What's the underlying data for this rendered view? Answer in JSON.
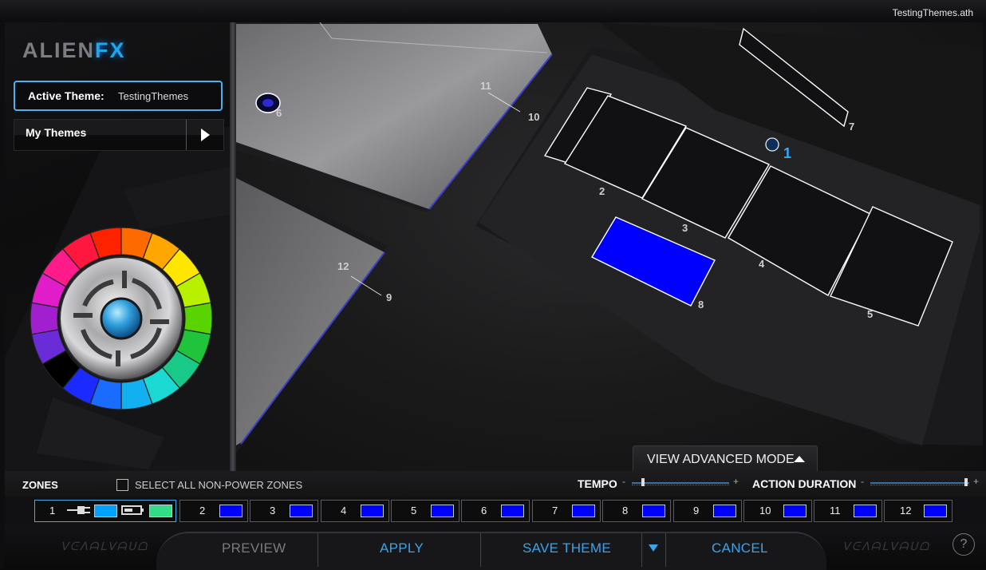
{
  "window": {
    "file_name": "TestingThemes.ath"
  },
  "sidebar": {
    "logo_part1": "ALIEN",
    "logo_part2": "FX",
    "active_theme_label": "Active Theme:",
    "active_theme_value": "TestingThemes",
    "my_themes_label": "My Themes"
  },
  "scene": {
    "zone_labels": [
      "1",
      "2",
      "3",
      "4",
      "5",
      "6",
      "7",
      "8",
      "9",
      "10",
      "11",
      "12"
    ],
    "view_advanced_label": "VIEW ADVANCED MODE"
  },
  "zones_bar": {
    "zones_label": "ZONES",
    "select_all_label": "SELECT ALL NON-POWER ZONES",
    "tempo_label": "TEMPO",
    "action_duration_label": "ACTION DURATION",
    "slider_minus": "-",
    "slider_plus": "+",
    "tempo_level": 0.1,
    "action_duration_level": 0.95
  },
  "zones": [
    {
      "label": "1",
      "power": true,
      "ac_color": "#00a2ff",
      "battery_color": "#33dd88"
    },
    {
      "label": "2",
      "color": "#0000ff"
    },
    {
      "label": "3",
      "color": "#0000ff"
    },
    {
      "label": "4",
      "color": "#0000ff"
    },
    {
      "label": "5",
      "color": "#0000ff"
    },
    {
      "label": "6",
      "color": "#0000ff"
    },
    {
      "label": "7",
      "color": "#0000ff"
    },
    {
      "label": "8",
      "color": "#0000ff"
    },
    {
      "label": "9",
      "color": "#0000ff"
    },
    {
      "label": "10",
      "color": "#0000ff"
    },
    {
      "label": "11",
      "color": "#0000ff"
    },
    {
      "label": "12",
      "color": "#0000ff"
    }
  ],
  "actions": {
    "preview": "PREVIEW",
    "apply": "APPLY",
    "save_theme": "SAVE THEME",
    "cancel": "CANCEL",
    "help": "?"
  },
  "colors": {
    "accent": "#3aa3ea",
    "zone_blue": "#0000ff"
  }
}
